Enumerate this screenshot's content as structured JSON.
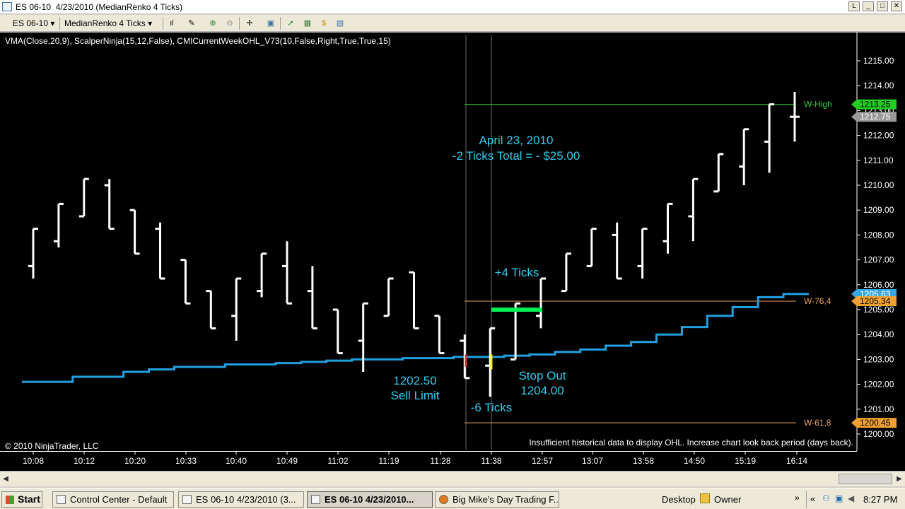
{
  "window": {
    "title": "ES 06-10  4/23/2010 (MedianRenko 4 Ticks)",
    "controls": [
      "L",
      "_",
      "□",
      "✕"
    ]
  },
  "toolbar": {
    "instrument": "ES 06-10",
    "period": "MedianRenko 4 Ticks"
  },
  "chart": {
    "indicator_label": "VMA(Close,20,9), ScalperNinja(15,12,False), CMICurrentWeekOHL_V73(10,False,Right,True,True,15)",
    "copyright": "© 2010 NinjaTrader, LLC",
    "notice": "Insufficient historical data to display OHL. Increase chart look back period (days back).",
    "annotations": {
      "date": "April 23, 2010",
      "total": "-2 Ticks Total = - $25.00",
      "entry_price": "1202.50",
      "entry_type": "Sell Limit",
      "loss": "-6 Ticks",
      "stop_label": "Stop Out",
      "stop_price": "1204.00",
      "gain": "+4 Ticks"
    },
    "levels": [
      {
        "label": "W-High",
        "price": 1213.25,
        "color": "#33cc33",
        "tag": "1213.25"
      },
      {
        "label": "W-76,4",
        "price": 1205.34,
        "color": "#e8a060",
        "tag": "1205.34"
      },
      {
        "label": "W-61,8",
        "price": 1200.45,
        "color": "#e8a060",
        "tag": "1200.45"
      }
    ],
    "price_tags": [
      {
        "text": "1212.75",
        "price": 1212.75,
        "bg": "#9a9a9a"
      },
      {
        "text": "1205.63",
        "price": 1205.63,
        "bg": "#3aa8e0"
      }
    ],
    "colors": {
      "bars": "#ffffff",
      "vma": "#22a0e0",
      "text": "#33ccee",
      "stop": "#00ee55",
      "short": "#dd3333",
      "long": "#ffee00"
    },
    "x_ticks": [
      "10:08",
      "10:12",
      "10:20",
      "10:33",
      "10:40",
      "10:49",
      "11:02",
      "11:19",
      "11:28",
      "11:38",
      "12:57",
      "13:07",
      "13:58",
      "14:50",
      "15:19",
      "16:14"
    ],
    "y_ticks": [
      "1215.00",
      "1214.00",
      "1213.00",
      "1212.00",
      "1211.00",
      "1210.00",
      "1209.00",
      "1208.00",
      "1207.00",
      "1206.00",
      "1205.00",
      "1204.00",
      "1203.00",
      "1202.00",
      "1201.00",
      "1200.00"
    ]
  },
  "chart_data": {
    "type": "bar",
    "title": "",
    "xlabel": "",
    "ylabel": "",
    "ylim": [
      1199.8,
      1215.6
    ],
    "bars": [
      {
        "o": 1206.75,
        "h": 1208.25,
        "l": 1206.25,
        "c": 1208.25
      },
      {
        "o": 1207.75,
        "h": 1209.25,
        "l": 1207.5,
        "c": 1209.25
      },
      {
        "o": 1208.75,
        "h": 1210.25,
        "l": 1208.75,
        "c": 1210.25
      },
      {
        "o": 1210.0,
        "h": 1210.25,
        "l": 1208.25,
        "c": 1208.25
      },
      {
        "o": 1209.0,
        "h": 1209.0,
        "l": 1207.25,
        "c": 1207.25
      },
      {
        "o": 1208.25,
        "h": 1208.5,
        "l": 1206.25,
        "c": 1206.25
      },
      {
        "o": 1207.0,
        "h": 1207.0,
        "l": 1205.25,
        "c": 1205.25
      },
      {
        "o": 1205.75,
        "h": 1205.75,
        "l": 1204.25,
        "c": 1204.25
      },
      {
        "o": 1204.75,
        "h": 1206.25,
        "l": 1203.75,
        "c": 1206.25
      },
      {
        "o": 1205.75,
        "h": 1207.25,
        "l": 1205.5,
        "c": 1207.25
      },
      {
        "o": 1206.75,
        "h": 1207.75,
        "l": 1205.25,
        "c": 1205.25
      },
      {
        "o": 1205.75,
        "h": 1206.75,
        "l": 1204.25,
        "c": 1204.25
      },
      {
        "o": 1205.0,
        "h": 1205.0,
        "l": 1203.25,
        "c": 1203.25
      },
      {
        "o": 1203.75,
        "h": 1205.25,
        "l": 1202.5,
        "c": 1205.25
      },
      {
        "o": 1204.75,
        "h": 1206.25,
        "l": 1204.75,
        "c": 1206.25
      },
      {
        "o": 1206.5,
        "h": 1206.5,
        "l": 1204.25,
        "c": 1204.25
      },
      {
        "o": 1204.75,
        "h": 1204.75,
        "l": 1203.25,
        "c": 1203.25
      },
      {
        "o": 1203.75,
        "h": 1204.0,
        "l": 1202.25,
        "c": 1202.25
      },
      {
        "o": 1202.75,
        "h": 1204.25,
        "l": 1201.5,
        "c": 1204.25
      },
      {
        "o": 1203.0,
        "h": 1205.25,
        "l": 1203.0,
        "c": 1205.25
      },
      {
        "o": 1204.75,
        "h": 1206.25,
        "l": 1204.25,
        "c": 1206.25
      },
      {
        "o": 1205.75,
        "h": 1207.25,
        "l": 1205.75,
        "c": 1207.25
      },
      {
        "o": 1206.75,
        "h": 1208.25,
        "l": 1206.75,
        "c": 1208.25
      },
      {
        "o": 1208.0,
        "h": 1208.5,
        "l": 1206.25,
        "c": 1206.25
      },
      {
        "o": 1206.75,
        "h": 1208.25,
        "l": 1206.25,
        "c": 1208.25
      },
      {
        "o": 1207.75,
        "h": 1209.25,
        "l": 1207.25,
        "c": 1209.25
      },
      {
        "o": 1208.75,
        "h": 1210.25,
        "l": 1207.75,
        "c": 1210.25
      },
      {
        "o": 1209.75,
        "h": 1211.25,
        "l": 1209.75,
        "c": 1211.25
      },
      {
        "o": 1210.75,
        "h": 1212.25,
        "l": 1210.0,
        "c": 1212.25
      },
      {
        "o": 1211.75,
        "h": 1213.25,
        "l": 1210.5,
        "c": 1213.25
      },
      {
        "o": 1212.75,
        "h": 1213.75,
        "l": 1211.75,
        "c": 1212.75
      }
    ],
    "vma": [
      1202.1,
      1202.1,
      1202.3,
      1202.3,
      1202.5,
      1202.6,
      1202.7,
      1202.7,
      1202.8,
      1202.8,
      1202.85,
      1202.9,
      1202.95,
      1203.0,
      1203.0,
      1203.05,
      1203.05,
      1203.1,
      1203.1,
      1203.15,
      1203.2,
      1203.3,
      1203.4,
      1203.55,
      1203.7,
      1204.0,
      1204.3,
      1204.75,
      1205.1,
      1205.5,
      1205.63
    ]
  }
}
